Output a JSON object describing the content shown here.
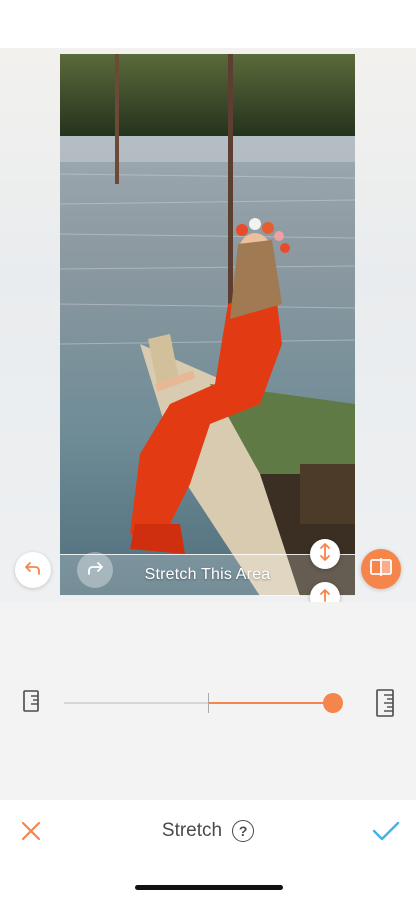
{
  "editor": {
    "stretch_area_label": "Stretch This Area",
    "tool_title": "Stretch",
    "help_symbol": "?"
  },
  "slider": {
    "value_fraction": 0.99,
    "center_fraction": 0.53
  },
  "icons": {
    "undo": "undo-arrow-icon",
    "redo": "redo-arrow-icon",
    "handle_top": "vertical-resize-icon",
    "handle_bottom": "arrow-up-icon",
    "compare": "split-compare-icon",
    "ruler_left": "ruler-small-icon",
    "ruler_right": "ruler-large-icon",
    "cancel": "close-icon",
    "apply": "checkmark-icon",
    "help": "help-circle-icon"
  },
  "colors": {
    "accent": "#f5854a",
    "apply": "#3fb4e6",
    "track": "#d6d6d6",
    "panel": "#f3f3f3"
  }
}
